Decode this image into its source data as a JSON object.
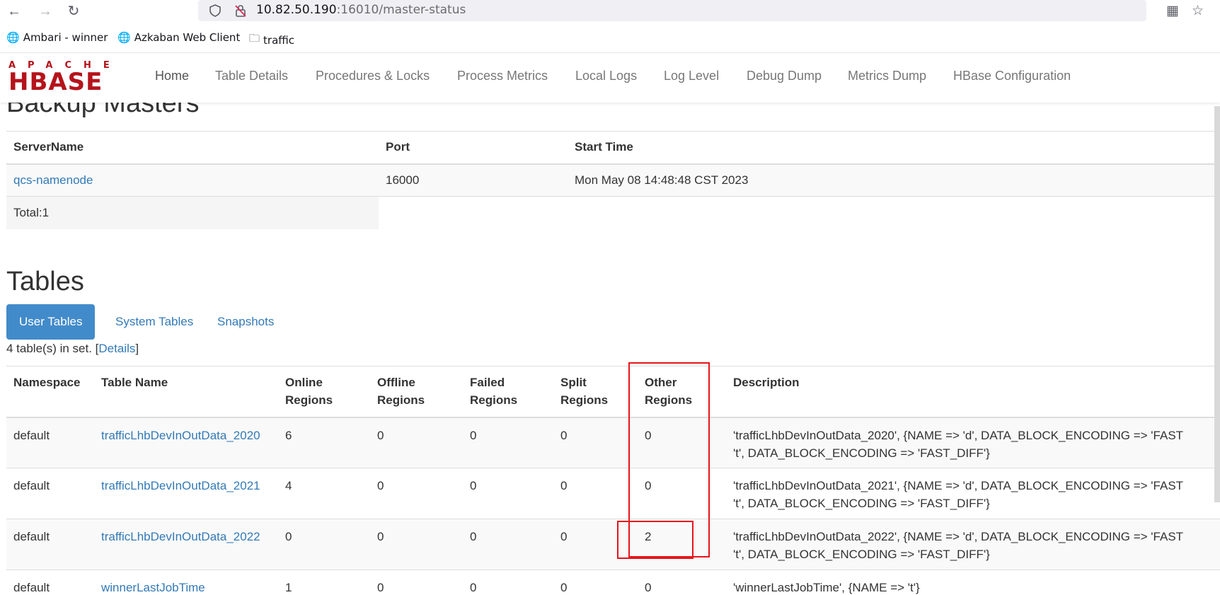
{
  "browser": {
    "url_host": "10.82.50.190",
    "url_rest": ":16010/master-status",
    "bookmarks": [
      "Ambari - winner",
      "Azkaban Web Client",
      "traffic"
    ]
  },
  "nav": {
    "logo_top": "APACHE",
    "logo_main": "HBASE",
    "items": [
      "Home",
      "Table Details",
      "Procedures & Locks",
      "Process Metrics",
      "Local Logs",
      "Log Level",
      "Debug Dump",
      "Metrics Dump",
      "HBase Configuration"
    ]
  },
  "backup_masters": {
    "heading": "Backup Masters",
    "columns": [
      "ServerName",
      "Port",
      "Start Time"
    ],
    "rows": [
      {
        "server": "qcs-namenode",
        "port": "16000",
        "start": "Mon May 08 14:48:48 CST 2023"
      }
    ],
    "total": "Total:1"
  },
  "tables": {
    "heading": "Tables",
    "tabs": [
      "User Tables",
      "System Tables",
      "Snapshots"
    ],
    "set_info_prefix": "4 table(s) in set. [",
    "set_info_link": "Details",
    "set_info_suffix": "]",
    "columns": [
      "Namespace",
      "Table Name",
      "Online Regions",
      "Offline Regions",
      "Failed Regions",
      "Split Regions",
      "Other Regions",
      "Description"
    ],
    "rows": [
      {
        "ns": "default",
        "name": "trafficLhbDevInOutData_2020",
        "online": "6",
        "offline": "0",
        "failed": "0",
        "split": "0",
        "other": "0",
        "desc1": "'trafficLhbDevInOutData_2020', {NAME => 'd', DATA_BLOCK_ENCODING => 'FAST",
        "desc2": "'t', DATA_BLOCK_ENCODING => 'FAST_DIFF'}"
      },
      {
        "ns": "default",
        "name": "trafficLhbDevInOutData_2021",
        "online": "4",
        "offline": "0",
        "failed": "0",
        "split": "0",
        "other": "0",
        "desc1": "'trafficLhbDevInOutData_2021', {NAME => 'd', DATA_BLOCK_ENCODING => 'FAST",
        "desc2": "'t', DATA_BLOCK_ENCODING => 'FAST_DIFF'}"
      },
      {
        "ns": "default",
        "name": "trafficLhbDevInOutData_2022",
        "online": "0",
        "offline": "0",
        "failed": "0",
        "split": "0",
        "other": "2",
        "desc1": "'trafficLhbDevInOutData_2022', {NAME => 'd', DATA_BLOCK_ENCODING => 'FAST",
        "desc2": "'t', DATA_BLOCK_ENCODING => 'FAST_DIFF'}"
      },
      {
        "ns": "default",
        "name": "winnerLastJobTime",
        "online": "1",
        "offline": "0",
        "failed": "0",
        "split": "0",
        "other": "0",
        "desc1": "'winnerLastJobTime', {NAME => 't'}",
        "desc2": ""
      }
    ]
  },
  "colors": {
    "link": "#337ab7",
    "active_tab": "#428bca",
    "logo": "#b5131b",
    "annotation": "#e8141b"
  }
}
